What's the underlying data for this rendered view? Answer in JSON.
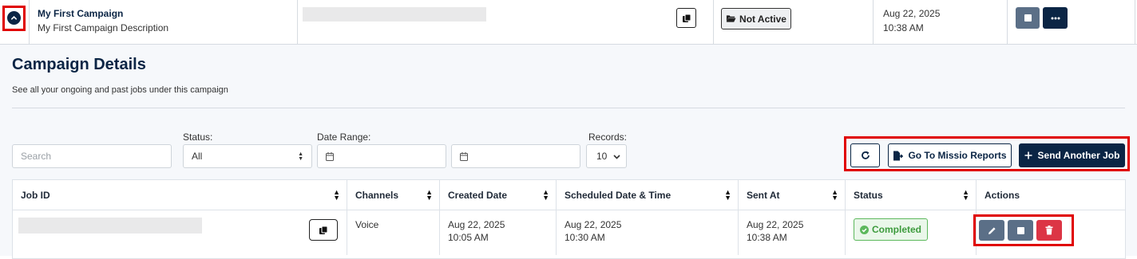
{
  "campaign": {
    "name": "My First Campaign",
    "description": "My First Campaign Description",
    "status_label": "Not Active",
    "date": "Aug 22, 2025",
    "time": "10:38 AM"
  },
  "details": {
    "title": "Campaign Details",
    "subtitle": "See all your ongoing and past jobs under this campaign"
  },
  "filters": {
    "search_placeholder": "Search",
    "status_label": "Status:",
    "status_value": "All",
    "date_range_label": "Date Range:",
    "records_label": "Records:",
    "records_value": "10"
  },
  "actions": {
    "reports_label": "Go To Missio Reports",
    "send_label": "Send Another Job"
  },
  "table": {
    "headers": [
      "Job ID",
      "Channels",
      "Created Date",
      "Scheduled Date & Time",
      "Sent At",
      "Status",
      "Actions"
    ],
    "row": {
      "channel": "Voice",
      "created_date": "Aug 22, 2025",
      "created_time": "10:05 AM",
      "scheduled_date": "Aug 22, 2025",
      "scheduled_time": "10:30 AM",
      "sent_date": "Aug 22, 2025",
      "sent_time": "10:38 AM",
      "status": "Completed"
    }
  },
  "colors": {
    "navy": "#0b2545",
    "slate": "#5b6f87",
    "danger": "#dc3545",
    "success": "#5cb85c",
    "highlight": "#e00000"
  }
}
